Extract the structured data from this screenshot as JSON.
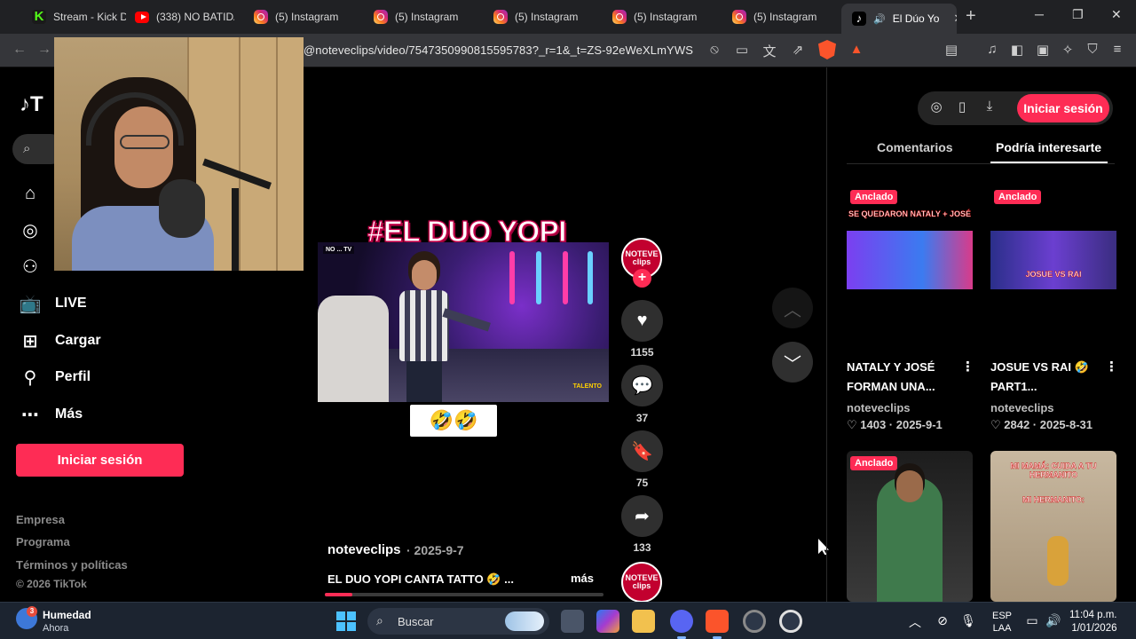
{
  "browser": {
    "tabs": [
      {
        "label": "Stream - Kick Das",
        "icon": "kick-icon"
      },
      {
        "label": "(338) NO BATIDÃ",
        "icon": "youtube-icon"
      },
      {
        "label": "(5) Instagram",
        "icon": "instagram-icon"
      },
      {
        "label": "(5) Instagram",
        "icon": "instagram-icon"
      },
      {
        "label": "(5) Instagram",
        "icon": "instagram-icon"
      },
      {
        "label": "(5) Instagram",
        "icon": "instagram-icon"
      },
      {
        "label": "(5) Instagram",
        "icon": "instagram-icon"
      },
      {
        "label": "El Dúo Yo",
        "icon": "tiktok-icon",
        "active": true
      }
    ],
    "url": "@noteveclips/video/7547350990815595783?_r=1&_t=ZS-92eWeXLmYWS",
    "brave_badge_count": "1"
  },
  "sidebar": {
    "logo": "T",
    "items": [
      {
        "label": "LIVE",
        "icon": "live-tv-icon"
      },
      {
        "label": "Cargar",
        "icon": "upload-plus-icon"
      },
      {
        "label": "Perfil",
        "icon": "profile-icon"
      },
      {
        "label": "Más",
        "icon": "more-dots-icon"
      }
    ],
    "login_label": "Iniciar sesión",
    "footer_links": [
      "Empresa",
      "Programa",
      "Términos y políticas"
    ],
    "copyright": "© 2026 TikTok"
  },
  "video": {
    "overlay_title": "#EL DUO YOPI",
    "frame_tag": "NO ... TV",
    "frame_tag2": "TALENTO",
    "emoji_caption": "🤣🤣",
    "author": "noteveclips",
    "date": "· 2025-9-7",
    "description": "EL DUO YOPI CANTA TATTO 🤣 ...",
    "more_label": "más",
    "progress": 0.1,
    "avatar_text_1": "NOTEVE",
    "avatar_text_2": "clips",
    "likes": "1155",
    "comments": "37",
    "saves": "75",
    "shares": "133"
  },
  "right_panel": {
    "login_label": "Iniciar sesión",
    "tab_comments": "Comentarios",
    "tab_interest": "Podría interesarte",
    "cards": [
      {
        "pinned": "Anclado",
        "overlay": "SE QUEDARON NATALY + JOSÉ",
        "title": "NATALY Y JOSÉ FORMAN UNA...",
        "author": "noteveclips",
        "stats": "♡ 1403 · 2025-9-1"
      },
      {
        "pinned": "Anclado",
        "overlay": "JOSUE VS RAI",
        "title": "JOSUE VS RAI 🤣 PART1...",
        "author": "noteveclips",
        "stats": "♡ 2842 · 2025-8-31"
      },
      {
        "pinned": "Anclado",
        "overlay": "",
        "title": "",
        "author": "",
        "stats": ""
      },
      {
        "pinned": "",
        "overlay": "MI MAMÁ: CUIDA A TU HERMANITO",
        "overlay2": "MI HERMANITO:",
        "title": "",
        "author": "",
        "stats": ""
      }
    ]
  },
  "taskbar": {
    "weather_title": "Humedad",
    "weather_sub": "Ahora",
    "weather_badge": "3",
    "search_label": "Buscar",
    "lang_1": "ESP",
    "lang_2": "LAA",
    "time": "11:04 p.m.",
    "date": "1/01/2026"
  },
  "colors": {
    "tiktok_red": "#fe2c55",
    "taskbar_bg": "#1c2430",
    "browser_tab_bg": "#202124",
    "toolbar_bg": "#35363a"
  }
}
